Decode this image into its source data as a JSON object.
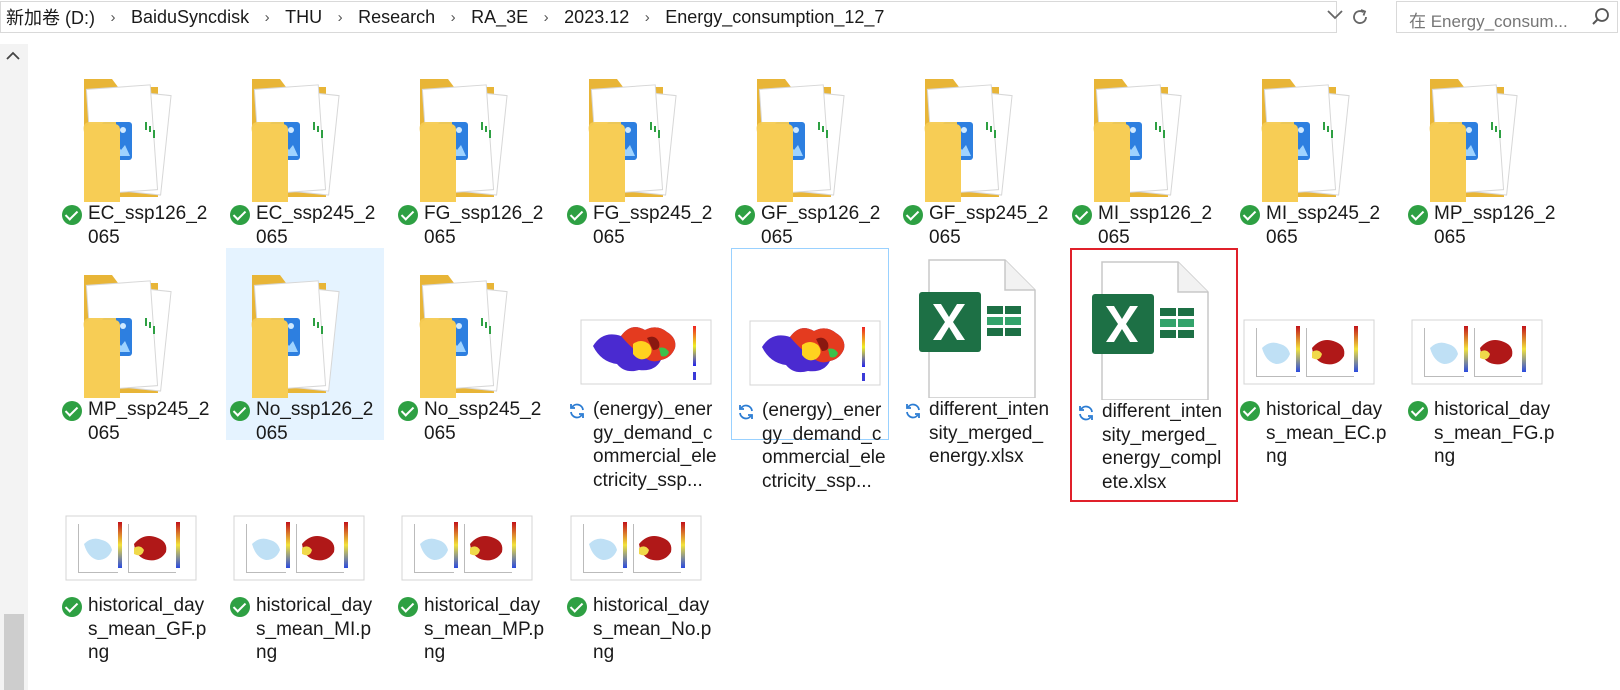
{
  "address_bar": {
    "crumbs": [
      "新加卷 (D:)",
      "BaiduSyncdisk",
      "THU",
      "Research",
      "RA_3E",
      "2023.12",
      "Energy_consumption_12_7"
    ],
    "dropdown_icon": "chevron-down-icon",
    "refresh_icon": "refresh-icon"
  },
  "search": {
    "placeholder": "在 Energy_consum..."
  },
  "items": [
    {
      "name": "EC_ssp126_2065",
      "type": "folder",
      "status": "synced"
    },
    {
      "name": "EC_ssp245_2065",
      "type": "folder",
      "status": "synced"
    },
    {
      "name": "FG_ssp126_2065",
      "type": "folder",
      "status": "synced"
    },
    {
      "name": "FG_ssp245_2065",
      "type": "folder",
      "status": "synced"
    },
    {
      "name": "GF_ssp126_2065",
      "type": "folder",
      "status": "synced"
    },
    {
      "name": "GF_ssp245_2065",
      "type": "folder",
      "status": "synced"
    },
    {
      "name": "MI_ssp126_2065",
      "type": "folder",
      "status": "synced"
    },
    {
      "name": "MI_ssp245_2065",
      "type": "folder",
      "status": "synced"
    },
    {
      "name": "MP_ssp126_2065",
      "type": "folder",
      "status": "synced"
    },
    {
      "name": "MP_ssp245_2065",
      "type": "folder",
      "status": "synced"
    },
    {
      "name": "No_ssp126_2065",
      "type": "folder",
      "status": "synced"
    },
    {
      "name": "No_ssp245_2065",
      "type": "folder",
      "status": "synced"
    },
    {
      "name": "(energy)_energy_demand_commercial_electricity_ssp...",
      "type": "map-png",
      "status": "syncing"
    },
    {
      "name": "(energy)_energy_demand_commercial_electricity_ssp...",
      "type": "map-png",
      "status": "syncing"
    },
    {
      "name": "different_intensity_merged_energy.xlsx",
      "type": "xlsx",
      "status": "syncing"
    },
    {
      "name": "different_intensity_merged_energy_complete.xlsx",
      "type": "xlsx",
      "status": "syncing"
    },
    {
      "name": "historical_days_mean_EC.png",
      "type": "plot-png",
      "status": "synced"
    },
    {
      "name": "historical_days_mean_FG.png",
      "type": "plot-png",
      "status": "synced"
    },
    {
      "name": "historical_days_mean_GF.png",
      "type": "plot-png",
      "status": "synced"
    },
    {
      "name": "historical_days_mean_MI.png",
      "type": "plot-png",
      "status": "synced"
    },
    {
      "name": "historical_days_mean_MP.png",
      "type": "plot-png",
      "status": "synced"
    },
    {
      "name": "historical_days_mean_No.png",
      "type": "plot-png",
      "status": "synced"
    }
  ],
  "colors": {
    "folder": "#f5c84c",
    "excel": "#1d7045",
    "sync_green": "#2ea043",
    "sync_blue": "#2b7cd3",
    "highlight_box": "#e0202a",
    "selection": "#e5f3ff"
  }
}
